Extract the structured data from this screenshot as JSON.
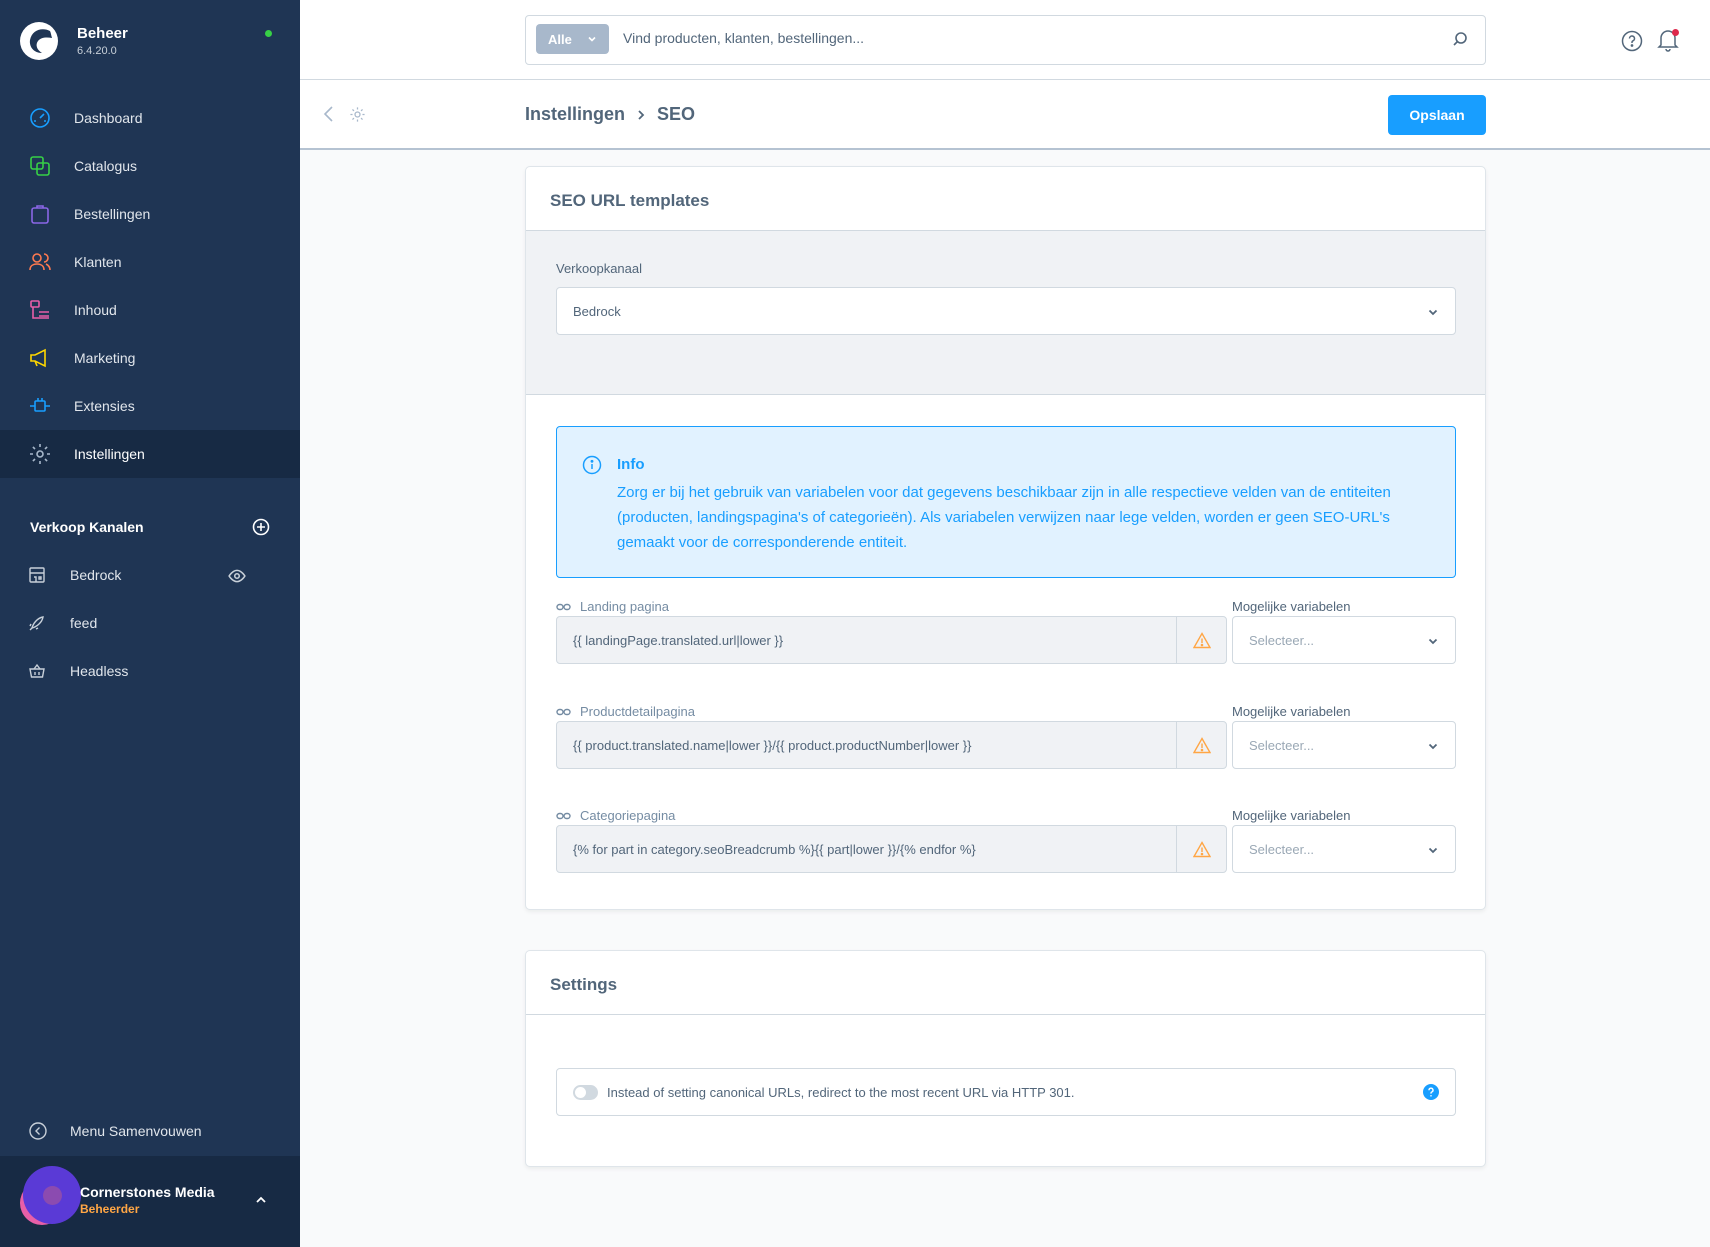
{
  "brand": {
    "title": "Beheer",
    "version": "6.4.20.0"
  },
  "nav": [
    {
      "label": "Dashboard",
      "icon": "gauge-icon",
      "color": "#189eff"
    },
    {
      "label": "Catalogus",
      "icon": "catalog-icon",
      "color": "#37d046"
    },
    {
      "label": "Bestellingen",
      "icon": "shopping-bag-icon",
      "color": "#8a66e6"
    },
    {
      "label": "Klanten",
      "icon": "users-icon",
      "color": "#ff7a50"
    },
    {
      "label": "Inhoud",
      "icon": "content-icon",
      "color": "#e85fa8"
    },
    {
      "label": "Marketing",
      "icon": "megaphone-icon",
      "color": "#ffd700"
    },
    {
      "label": "Extensies",
      "icon": "plug-icon",
      "color": "#189eff"
    },
    {
      "label": "Instellingen",
      "icon": "cog-icon",
      "color": "#a8b8cb"
    }
  ],
  "sales_channels": {
    "title": "Verkoop Kanalen",
    "items": [
      {
        "label": "Bedrock",
        "icon": "storefront-icon"
      },
      {
        "label": "feed",
        "icon": "rocket-icon"
      },
      {
        "label": "Headless",
        "icon": "basket-icon"
      }
    ]
  },
  "collapse_label": "Menu Samenvouwen",
  "user": {
    "name": "Cornerstones Media",
    "role": "Beheerder"
  },
  "search": {
    "type_label": "Alle",
    "placeholder": "Vind producten, klanten, bestellingen..."
  },
  "breadcrumb": {
    "parent": "Instellingen",
    "current": "SEO"
  },
  "save_label": "Opslaan",
  "seo_card": {
    "title": "SEO URL templates",
    "sales_channel_label": "Verkoopkanaal",
    "sales_channel_value": "Bedrock",
    "info": {
      "title": "Info",
      "text": "Zorg er bij het gebruik van variabelen voor dat gegevens beschikbaar zijn in alle respectieve velden van de entiteiten (producten, landingspagina's of categorieën). Als variabelen verwijzen naar lege velden, worden er geen SEO-URL's gemaakt voor de corresponderende entiteit."
    },
    "templates": [
      {
        "label": "Landing pagina",
        "value": "{{ landingPage.translated.url|lower }}",
        "var_label": "Mogelijke variabelen",
        "var_placeholder": "Selecteer..."
      },
      {
        "label": "Productdetailpagina",
        "value": "{{ product.translated.name|lower }}/{{ product.productNumber|lower }}",
        "var_label": "Mogelijke variabelen",
        "var_placeholder": "Selecteer..."
      },
      {
        "label": "Categoriepagina",
        "value": "{% for part in category.seoBreadcrumb %}{{ part|lower }}/{% endfor %}",
        "var_label": "Mogelijke variabelen",
        "var_placeholder": "Selecteer..."
      }
    ]
  },
  "settings_card": {
    "title": "Settings",
    "redirect_label": "Instead of setting canonical URLs, redirect to the most recent URL via HTTP 301.",
    "redirect_enabled": false
  },
  "colors": {
    "primary": "#189eff",
    "sidebar": "#1f3554",
    "warning": "#ffa645"
  }
}
